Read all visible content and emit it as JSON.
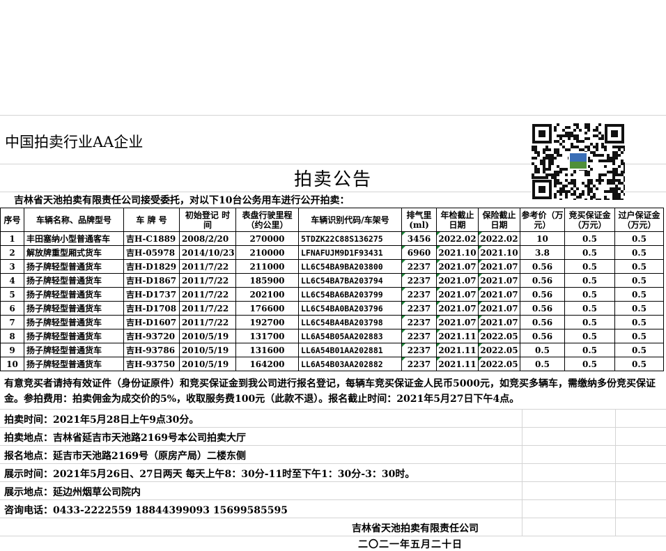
{
  "header": {
    "company_tag": "中国拍卖行业AA企业",
    "title": "拍卖公告",
    "intro": "吉林省天池拍卖有限责任公司接受委托，对以下10台公务用车进行公开拍卖："
  },
  "table": {
    "headers": [
      "序号",
      "车辆名称、品牌型号",
      "车 牌 号",
      "初始登记 时 间",
      "表盘行驶里程（约公里）",
      "车辆识别代码/车架号",
      "排气里(ml)",
      "年检截止日期",
      "保险截止日期",
      "参考价（万元）",
      "竞买保证金（万元）",
      "过户保证金（万元）"
    ],
    "rows": [
      [
        "1",
        "丰田塞纳小型普通客车",
        "吉H-C1889",
        "2008/2/20",
        "270000",
        "5TDZK22C88S136275",
        "3456",
        "2022.02",
        "2022.02",
        "10",
        "0.5",
        "0.5"
      ],
      [
        "2",
        "解放牌重型厢式货车",
        "吉H-05978",
        "2014/10/23",
        "210000",
        "LFNAFUJM9D1F93431",
        "6960",
        "2021.10",
        "2021.10",
        "3.8",
        "0.5",
        "0.5"
      ],
      [
        "3",
        "扬子牌轻型普通货车",
        "吉H-D1829",
        "2011/7/22",
        "211000",
        "LL6C54BA9BA203800",
        "2237",
        "2021.07",
        "2021.07",
        "0.56",
        "0.5",
        "0.5"
      ],
      [
        "4",
        "扬子牌轻型普通货车",
        "吉H-D1867",
        "2011/7/22",
        "185900",
        "LL6C54BA7BA203794",
        "2237",
        "2021.07",
        "2021.07",
        "0.56",
        "0.5",
        "0.5"
      ],
      [
        "5",
        "扬子牌轻型普通货车",
        "吉H-D1737",
        "2011/7/22",
        "202100",
        "LL6C54BA6BA203799",
        "2237",
        "2021.07",
        "2021.07",
        "0.56",
        "0.5",
        "0.5"
      ],
      [
        "6",
        "扬子牌轻型普通货车",
        "吉H-D1708",
        "2011/7/22",
        "176600",
        "LL6C54BA0BA203796",
        "2237",
        "2021.07",
        "2021.07",
        "0.56",
        "0.5",
        "0.5"
      ],
      [
        "7",
        "扬子牌轻型普通货车",
        "吉H-D1607",
        "2011/7/22",
        "192700",
        "LL6C54BA4BA203798",
        "2237",
        "2021.07",
        "2021.07",
        "0.56",
        "0.5",
        "0.5"
      ],
      [
        "8",
        "扬子牌轻型普通货车",
        "吉H-93720",
        "2010/5/19",
        "131700",
        "LL6A54B05AA202883",
        "2237",
        "2021.11",
        "2022.05",
        "0.56",
        "0.5",
        "0.5"
      ],
      [
        "9",
        "扬子牌轻型普通货车",
        "吉H-93786",
        "2010/5/19",
        "131600",
        "LL6A54B01AA202881",
        "2237",
        "2021.11",
        "2022.05",
        "0.5",
        "0.5",
        "0.5"
      ],
      [
        "10",
        "扬子牌轻型普通货车",
        "吉H-93750",
        "2010/5/19",
        "164200",
        "LL6A54B03AA202882",
        "2237",
        "2021.11",
        "2022.05",
        "0.5",
        "0.5",
        "0.5"
      ]
    ]
  },
  "notice": {
    "paragraph": "有意竞买者请持有效证件（身份证原件）和竞买保证金到我公司进行报名登记，每辆车竞买保证金人民币5000元，如竞买多辆车，需缴纳多份竞买保证金。参拍费用：拍卖佣金为成交价的5%，收取服务费100元（此款不退）。报名截止时间：2021年5月27日下午4点。",
    "auction_time": "拍卖时间：2021年5月28日上午9点30分。",
    "auction_place": "拍卖地点：吉林省延吉市天池路2169号本公司拍卖大厅",
    "signup_place": "报名地点：延吉市天池路2169号（原房产局）二楼东侧",
    "display_time": "展示时间：2021年5月26日、27日两天   每天上午8：30分-11时至下午1：30分-3：30时。",
    "display_place": "展示地点：延边州烟草公司院内",
    "phone": "咨询电话：0433-2222559 18844399093 15699585595"
  },
  "signature": {
    "company": "吉林省天池拍卖有限责任公司",
    "date": "二〇二一年五月二十日"
  },
  "colors": {
    "cell_marker": "#1e8a3a",
    "grid": "#d4d4d4"
  }
}
